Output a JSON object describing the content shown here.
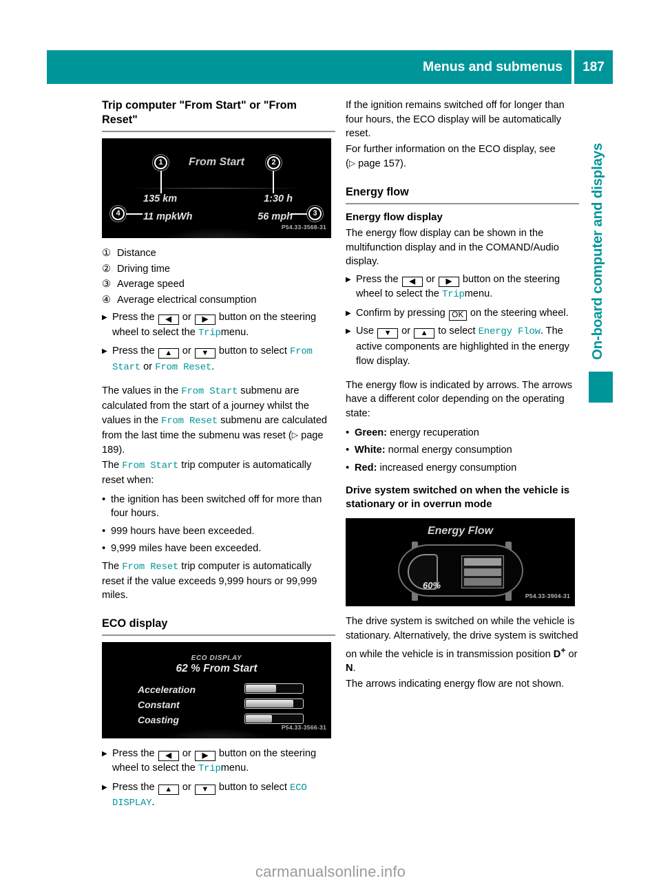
{
  "header": {
    "title": "Menus and submenus",
    "page_number": "187"
  },
  "side_tab": {
    "label": "On-board computer and displays"
  },
  "left_column": {
    "section_title": "Trip computer \"From Start\" or \"From Reset\"",
    "trip_screenshot": {
      "title": "From Start",
      "value_1": "135 km",
      "value_2": "1:30 h",
      "value_4": "11 mpkWh",
      "value_3": "56 mph",
      "callout_1": "1",
      "callout_2": "2",
      "callout_3": "3",
      "callout_4": "4",
      "code": "P54.33-3568-31"
    },
    "legend": [
      {
        "num": "①",
        "text": "Distance"
      },
      {
        "num": "②",
        "text": "Driving time"
      },
      {
        "num": "③",
        "text": "Average speed"
      },
      {
        "num": "④",
        "text": "Average electrical consumption"
      }
    ],
    "step1_a": "Press the",
    "step1_or": "or",
    "step1_b": "button on the steering wheel to select the",
    "step1_menu": "Trip",
    "step1_c": "menu.",
    "step2_a": "Press the",
    "step2_or": "or",
    "step2_b": "button to select",
    "step2_opt1": "From Start",
    "step2_join": "or",
    "step2_opt2": "From Reset",
    "step2_end": ".",
    "para1_a": "The values in the",
    "para1_m1": "From Start",
    "para1_b": "submenu are calculated from the start of a journey whilst the values in the",
    "para1_m2": "From Reset",
    "para1_c": "submenu are calculated from the last time the submenu was reset (",
    "para1_ref": "page 189",
    "para1_d": ").",
    "para2_a": "The",
    "para2_m": "From Start",
    "para2_b": "trip computer is automatically reset when:",
    "bullets": [
      "the ignition has been switched off for more than four hours.",
      "999 hours have been exceeded.",
      "9,999 miles have been exceeded."
    ],
    "para3_a": "The",
    "para3_m": "From Reset",
    "para3_b": "trip computer is automatically reset if the value exceeds 9,999 hours or 99,999 miles.",
    "eco_section_title": "ECO display",
    "eco_screenshot": {
      "title": "ECO DISPLAY",
      "subtitle": "62 % From Start",
      "rows": [
        {
          "label": "Acceleration",
          "fill_pct": 52
        },
        {
          "label": "Constant",
          "fill_pct": 82
        },
        {
          "label": "Coasting",
          "fill_pct": 45
        }
      ],
      "code": "P54.33-3566-31"
    },
    "eco_step1_a": "Press the",
    "eco_step1_or": "or",
    "eco_step1_b": "button on the steering wheel to select the",
    "eco_step1_menu": "Trip",
    "eco_step1_c": "menu.",
    "eco_step2_a": "Press the",
    "eco_step2_or": "or",
    "eco_step2_b": "button to select",
    "eco_step2_opt": "ECO DISPLAY",
    "eco_step2_end": "."
  },
  "right_column": {
    "para1": "If the ignition remains switched off for longer than four hours, the ECO display will be automatically reset.",
    "para2_a": "For further information on the ECO display, see (",
    "para2_ref": "page 157",
    "para2_b": ").",
    "section_title": "Energy flow",
    "sub_title": "Energy flow display",
    "para3": "The energy flow display can be shown in the multifunction display and in the COMAND/Audio display.",
    "step1_a": "Press the",
    "step1_or": "or",
    "step1_b": "button on the steering wheel to select the",
    "step1_menu": "Trip",
    "step1_c": "menu.",
    "step2_a": "Confirm by pressing",
    "step2_key": "OK",
    "step2_b": "on the steering wheel.",
    "step3_a": "Use",
    "step3_or": "or",
    "step3_b": "to select",
    "step3_opt": "Energy Flow",
    "step3_c": ". The active components are highlighted in the energy flow display.",
    "para4": "The energy flow is indicated by arrows. The arrows have a different color depending on the operating state:",
    "color_bullets": [
      {
        "label": "Green:",
        "text": "energy recuperation"
      },
      {
        "label": "White:",
        "text": "normal energy consumption"
      },
      {
        "label": "Red:",
        "text": "increased energy consumption"
      }
    ],
    "sub_title2": "Drive system switched on when the vehicle is stationary or in overrun mode",
    "energy_screenshot": {
      "title": "Energy Flow",
      "percent": "60%",
      "code": "P54.33-3904-31"
    },
    "para5_a": "The drive system is switched on while the vehicle is stationary. Alternatively, the drive system is switched on while the vehicle is in transmission position",
    "para5_d": "D",
    "para5_sup": "+",
    "para5_or": "or",
    "para5_n": "N",
    "para5_end": ".",
    "para6": "The arrows indicating energy flow are not shown."
  },
  "watermark": "carmanualsonline.info",
  "colors": {
    "accent_teal": "#009699",
    "rule_gray": "#8d9296"
  }
}
